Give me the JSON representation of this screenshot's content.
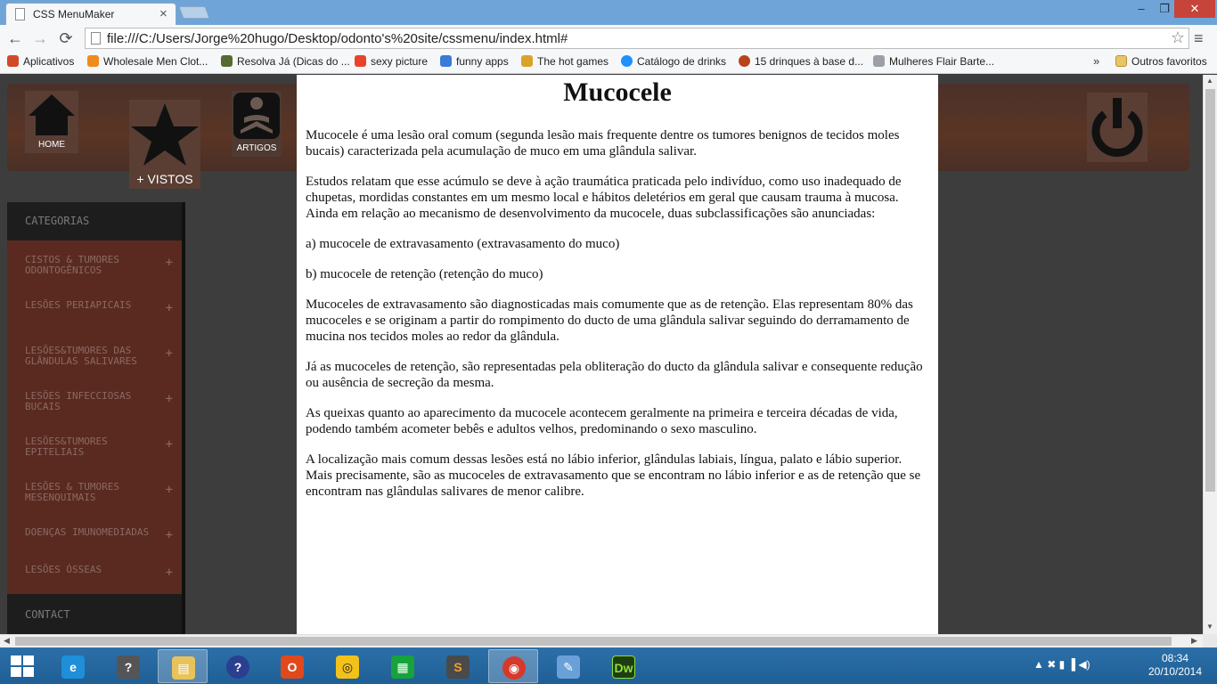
{
  "browser": {
    "tab_title": "CSS MenuMaker",
    "tab_close": "×",
    "url": "file:///C:/Users/Jorge%20hugo/Desktop/odonto's%20site/cssmenu/index.html#",
    "window_controls": {
      "minimize": "‒",
      "maximize": "❐",
      "close": "✕"
    },
    "nav": {
      "back": "←",
      "forward": "→",
      "reload": "⟳"
    },
    "star": "☆",
    "menu": "≡"
  },
  "bookmarks": {
    "items": [
      {
        "label": "Aplicativos",
        "color": "#d04a2a"
      },
      {
        "label": "Wholesale Men Clot...",
        "color": "#f08a1c"
      },
      {
        "label": "Resolva Já (Dicas do ...",
        "color": "#556b2f"
      },
      {
        "label": "sexy picture",
        "color": "#e8442a"
      },
      {
        "label": "funny apps",
        "color": "#3a7bd5"
      },
      {
        "label": "The hot games",
        "color": "#d9a22a"
      },
      {
        "label": "Catálogo de drinks",
        "color": "#1e90ff"
      },
      {
        "label": "15 drinques à base d...",
        "color": "#b8441c"
      },
      {
        "label": "Mulheres Flair Barte...",
        "color": "#9aa0a6"
      }
    ],
    "more": "»",
    "others": "Outros favoritos"
  },
  "header": {
    "home_label": "HOME",
    "vistos_label": "+ VISTOS",
    "artigos_label": "ARTIGOS"
  },
  "sidebar": {
    "header": "CATEGORIAS",
    "items": [
      {
        "label": "CISTOS & TUMORES ODONTOGÊNICOS",
        "plus": "+"
      },
      {
        "label": "LESÕES PERIAPICAIS",
        "plus": "+"
      },
      {
        "label": "LESÕES&TUMORES DAS GLÂNDULAS SALIVARES",
        "plus": "+"
      },
      {
        "label": "LESÕES INFECCIOSAS BUCAIS",
        "plus": "+"
      },
      {
        "label": "LESÕES&TUMORES EPITELIAIS",
        "plus": "+"
      },
      {
        "label": "LESÕES & TUMORES MESENQUIMAIS",
        "plus": "+"
      },
      {
        "label": "DOENÇAS IMUNOMEDIADAS",
        "plus": "+"
      },
      {
        "label": "LESÕES ÓSSEAS",
        "plus": "+"
      }
    ],
    "contact": "CONTACT"
  },
  "article": {
    "title": "Mucocele",
    "paragraphs": [
      "Mucocele é uma lesão oral comum (segunda lesão mais frequente dentre os tumores benignos de tecidos moles bucais) caracterizada pela acumulação de muco em uma glândula salivar.",
      "Estudos relatam que esse acúmulo se deve à ação traumática praticada pelo indivíduo, como uso inadequado de chupetas, mordidas constantes em um mesmo local e hábitos deletérios em geral que causam trauma à mucosa. Ainda em relação ao mecanismo de desenvolvimento da mucocele, duas subclassificações são anunciadas:",
      "a) mucocele de extravasamento (extravasamento do muco)",
      "b) mucocele de retenção (retenção do muco)",
      "Mucoceles de extravasamento são diagnosticadas mais comumente que as de retenção. Elas representam 80% das mucoceles e se originam a partir do rompimento do ducto de uma glândula salivar seguindo do derramamento de mucina nos tecidos moles ao redor da glândula.",
      "Já as mucoceles de retenção, são representadas pela obliteração do ducto da glândula salivar e consequente redução ou ausência de secreção da mesma.",
      "As queixas quanto ao aparecimento da mucocele acontecem geralmente na primeira e terceira décadas de vida, podendo também acometer bebês e adultos velhos, predominando o sexo masculino.",
      "A localização mais comum dessas lesões está no lábio inferior, glândulas labiais, língua, palato e lábio superior. Mais precisamente, são as mucoceles de extravasamento que se encontram no lábio inferior e as de retenção que se encontram nas glândulas salivares de menor calibre."
    ]
  },
  "taskbar": {
    "apps": [
      {
        "name": "internet-explorer",
        "glyph": "e",
        "color": "#1e8fd8",
        "active": false
      },
      {
        "name": "help-desk",
        "glyph": "?",
        "color": "#555",
        "active": false
      },
      {
        "name": "file-explorer",
        "glyph": "▤",
        "color": "#e8c35a",
        "active": true
      },
      {
        "name": "help",
        "glyph": "?",
        "color": "#2a3f8f",
        "active": false
      },
      {
        "name": "office",
        "glyph": "O",
        "color": "#e0491c",
        "active": false
      },
      {
        "name": "globe",
        "glyph": "◎",
        "color": "#f2c21a",
        "active": false
      },
      {
        "name": "store",
        "glyph": "▦",
        "color": "#17a23a",
        "active": false
      },
      {
        "name": "sublime",
        "glyph": "S",
        "color": "#4a4a4a",
        "active": false
      },
      {
        "name": "chrome",
        "glyph": "◉",
        "color": "#d6382b",
        "active": true
      },
      {
        "name": "paint",
        "glyph": "✎",
        "color": "#6aa0d8",
        "active": false
      },
      {
        "name": "dreamweaver",
        "glyph": "Dw",
        "color": "#1f3d12",
        "active": false
      }
    ],
    "tray": "▲  ✖  ▮  ▐  ◀)",
    "time": "08:34",
    "date": "20/10/2014"
  },
  "colors": {
    "title_bar": "#6fa4d8",
    "sidebar_bg": "#5a2a20",
    "header_bg": "#5a3525",
    "page_bg": "#3d3d3d"
  }
}
